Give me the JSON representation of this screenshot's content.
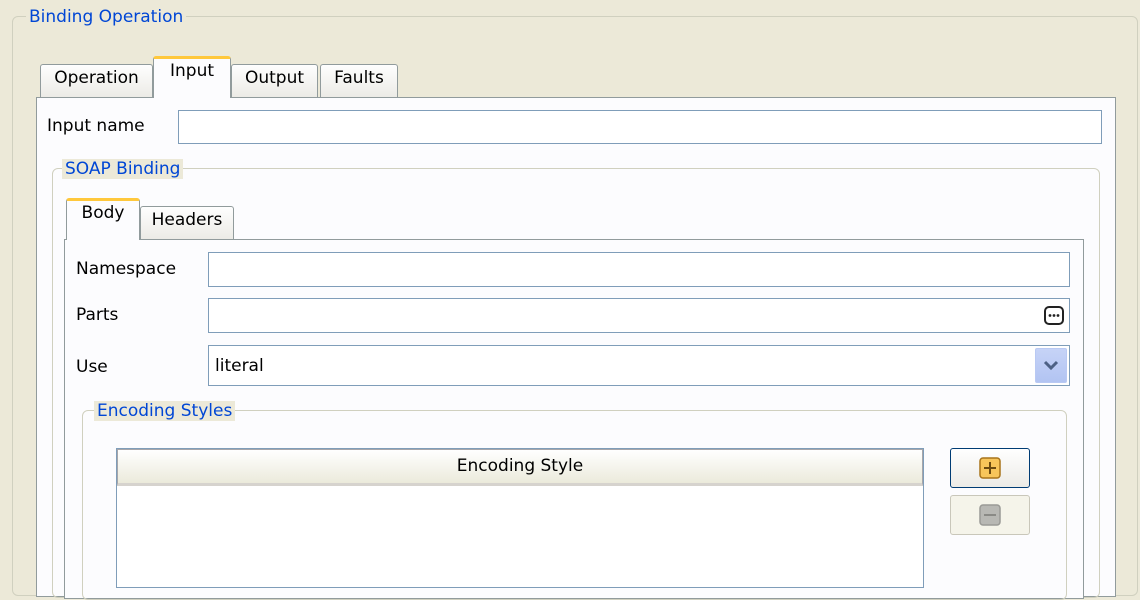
{
  "binding_operation": {
    "title": "Binding Operation",
    "tabs": [
      {
        "label": "Operation",
        "active": false
      },
      {
        "label": "Input",
        "active": true
      },
      {
        "label": "Output",
        "active": false
      },
      {
        "label": "Faults",
        "active": false
      }
    ],
    "input_name": {
      "label": "Input name",
      "value": ""
    }
  },
  "soap_binding": {
    "title": "SOAP Binding",
    "tabs": [
      {
        "label": "Body",
        "active": true
      },
      {
        "label": "Headers",
        "active": false
      }
    ],
    "namespace": {
      "label": "Namespace",
      "value": ""
    },
    "parts": {
      "label": "Parts",
      "value": "",
      "browse_icon": "ellipsis-icon"
    },
    "use": {
      "label": "Use",
      "value": "literal",
      "dropdown_icon": "chevron-down-icon"
    }
  },
  "encoding_styles": {
    "title": "Encoding Styles",
    "column_header": "Encoding Style",
    "rows": [],
    "add_icon": "plus-icon",
    "remove_icon": "minus-icon",
    "remove_enabled": false
  },
  "colors": {
    "background": "#ece9d8",
    "group_title": "#0046d5",
    "active_tab_accent": "#ffc83c",
    "field_border": "#7f9db9"
  }
}
